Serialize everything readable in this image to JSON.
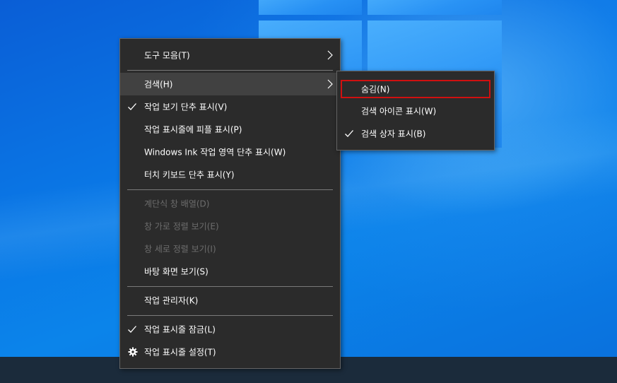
{
  "main_menu": {
    "toolbars": "도구 모음(T)",
    "search": "검색(H)",
    "show_task_view": "작업 보기 단추 표시(V)",
    "show_people": "작업 표시줄에 피플 표시(P)",
    "show_ink": "Windows Ink 작업 영역 단추 표시(W)",
    "show_keyboard": "터치 키보드 단추 표시(Y)",
    "cascade": "계단식 창 배열(D)",
    "stacked": "창 가로 정렬 보기(E)",
    "side_by_side": "창 세로 정렬 보기(I)",
    "show_desktop": "바탕 화면 보기(S)",
    "task_manager": "작업 관리자(K)",
    "lock_taskbar": "작업 표시줄 잠금(L)",
    "taskbar_settings": "작업 표시줄 설정(T)"
  },
  "search_submenu": {
    "hidden": "숨김(N)",
    "show_icon": "검색 아이콘 표시(W)",
    "show_box": "검색 상자 표시(B)"
  },
  "icons": {
    "checkmark": "check-icon",
    "submenu_arrow": "chevron-right-icon",
    "settings": "gear-icon"
  },
  "colors": {
    "menu_bg": "#2b2b2b",
    "hover_bg": "#414141",
    "disabled_text": "#6d6d6d",
    "highlight_border": "#d01010",
    "desktop_blue": "#0a78e6"
  }
}
